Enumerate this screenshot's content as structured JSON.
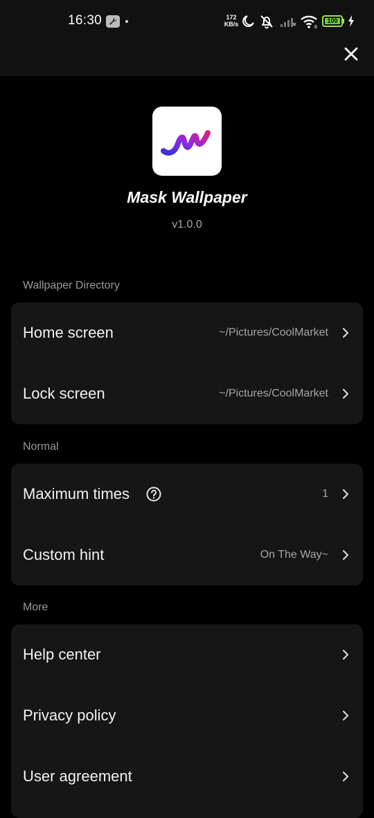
{
  "status_bar": {
    "time": "16:30",
    "net_speed_value": "172",
    "net_speed_unit": "KB/s",
    "battery": "100",
    "icons": [
      "wrench-icon",
      "moon-icon",
      "alarm-off-icon",
      "signal-icon",
      "wifi-icon",
      "battery-icon",
      "charging-icon"
    ]
  },
  "header": {
    "close_icon": "close-icon"
  },
  "app": {
    "name": "Mask Wallpaper",
    "version": "v1.0.0",
    "logo_colors": [
      "#3b2fd9",
      "#8a2be2",
      "#e0207a"
    ]
  },
  "sections": {
    "wallpaper": {
      "label": "Wallpaper Directory",
      "home": {
        "label": "Home screen",
        "value": "~/Pictures/CoolMarket"
      },
      "lock": {
        "label": "Lock screen",
        "value": "~/Pictures/CoolMarket"
      }
    },
    "normal": {
      "label": "Normal",
      "max_times": {
        "label": "Maximum times",
        "value": "1"
      },
      "custom_hint": {
        "label": "Custom hint",
        "value": "On The Way~"
      }
    },
    "more": {
      "label": "More",
      "help": {
        "label": "Help center"
      },
      "privacy": {
        "label": "Privacy policy"
      },
      "agreement": {
        "label": "User agreement"
      }
    }
  }
}
